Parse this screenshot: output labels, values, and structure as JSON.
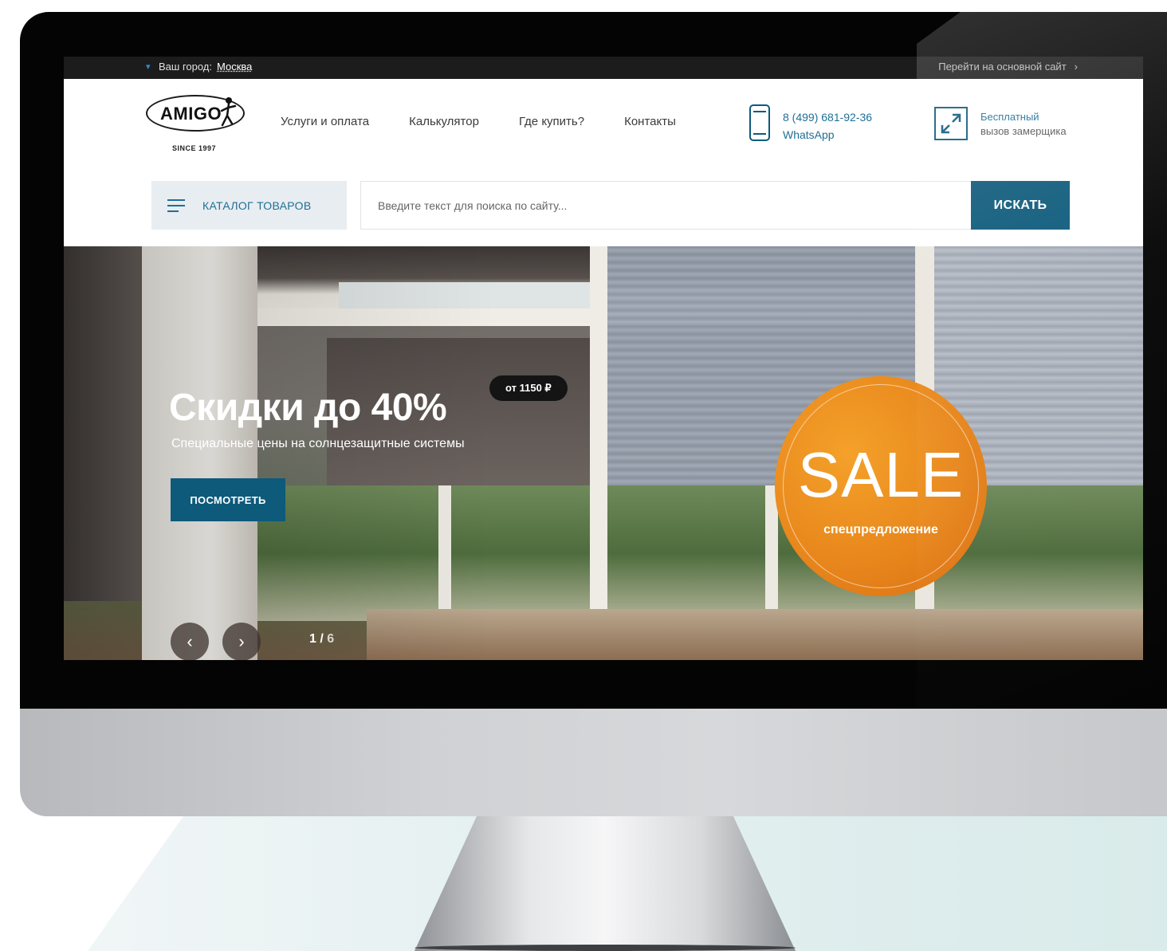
{
  "topbar": {
    "city_label": "Ваш город:",
    "city_value": "Москва",
    "main_site_link": "Перейти на основной сайт",
    "main_site_arrow": "›"
  },
  "logo": {
    "brand": "AMIGO",
    "since": "SINCE 1997"
  },
  "nav": {
    "items": [
      {
        "label": "Услуги и оплата"
      },
      {
        "label": "Калькулятор"
      },
      {
        "label": "Где купить?"
      },
      {
        "label": "Контакты"
      }
    ]
  },
  "contact": {
    "phone": "8 (499) 681-92-36",
    "messenger": "WhatsApp",
    "measure_line1": "Бесплатный",
    "measure_line2": "вызов замерщика"
  },
  "search": {
    "catalog_label": "КАТАЛОГ ТОВАРОВ",
    "placeholder": "Введите текст для поиска по сайту...",
    "button_label": "ИСКАТЬ"
  },
  "hero": {
    "title": "Скидки до 40%",
    "subtitle": "Специальные цены на солнцезащитные системы",
    "price_badge": "от 1150 ₽",
    "cta_label": "ПОСМОТРЕТЬ",
    "sale_word": "SALE",
    "sale_sub": "спецпредложение",
    "slide_current": "1",
    "slide_separator": " / ",
    "slide_total": "6",
    "prev_icon": "‹",
    "next_icon": "›"
  },
  "colors": {
    "accent": "#0d5a7b",
    "link": "#1f6f95",
    "sale_orange": "#e8871c",
    "topbar_bg": "#1c1c1c"
  }
}
